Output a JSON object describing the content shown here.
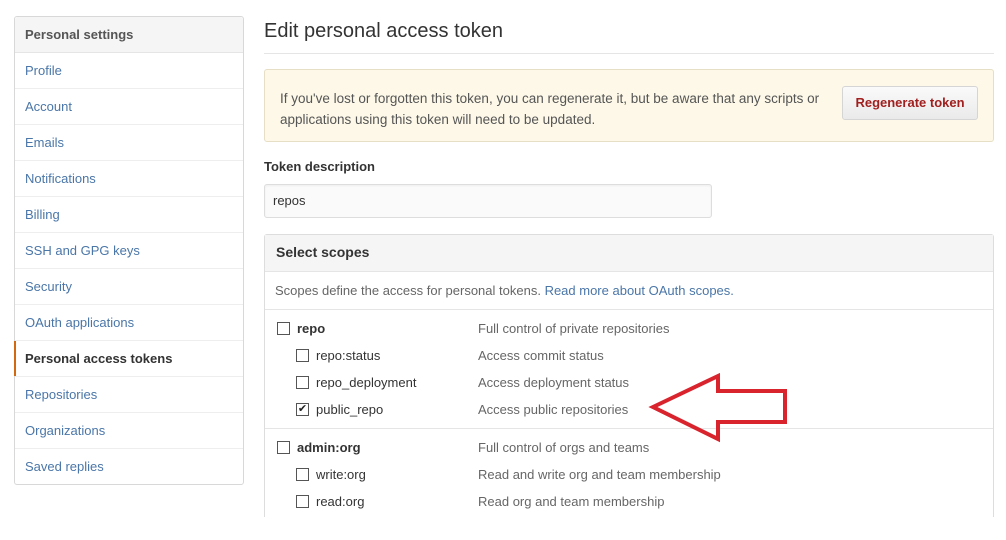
{
  "sidebar": {
    "header": "Personal settings",
    "items": [
      {
        "label": "Profile"
      },
      {
        "label": "Account"
      },
      {
        "label": "Emails"
      },
      {
        "label": "Notifications"
      },
      {
        "label": "Billing"
      },
      {
        "label": "SSH and GPG keys"
      },
      {
        "label": "Security"
      },
      {
        "label": "OAuth applications"
      },
      {
        "label": "Personal access tokens",
        "selected": true
      },
      {
        "label": "Repositories"
      },
      {
        "label": "Organizations"
      },
      {
        "label": "Saved replies"
      }
    ]
  },
  "main": {
    "title": "Edit personal access token",
    "flash": {
      "text": "If you've lost or forgotten this token, you can regenerate it, but be aware that any scripts or applications using this token will need to be updated.",
      "button_label": "Regenerate token"
    },
    "token_description": {
      "label": "Token description",
      "value": "repos"
    },
    "scopes": {
      "header": "Select scopes",
      "description": "Scopes define the access for personal tokens.",
      "link_text": "Read more about OAuth scopes.",
      "groups": [
        {
          "parent": {
            "name": "repo",
            "description": "Full control of private repositories",
            "checked": false
          },
          "children": [
            {
              "name": "repo:status",
              "description": "Access commit status",
              "checked": false
            },
            {
              "name": "repo_deployment",
              "description": "Access deployment status",
              "checked": false
            },
            {
              "name": "public_repo",
              "description": "Access public repositories",
              "checked": true
            }
          ]
        },
        {
          "parent": {
            "name": "admin:org",
            "description": "Full control of orgs and teams",
            "checked": false
          },
          "children": [
            {
              "name": "write:org",
              "description": "Read and write org and team membership",
              "checked": false
            },
            {
              "name": "read:org",
              "description": "Read org and team membership",
              "checked": false
            }
          ]
        }
      ]
    }
  },
  "annotation": {
    "arrow_color": "#d9232d",
    "points_to": "public_repo"
  },
  "colors": {
    "link": "#4a76a8",
    "selected_marker": "#d26911",
    "danger_text": "#a1201f",
    "flash_bg": "#fdf8e8"
  }
}
